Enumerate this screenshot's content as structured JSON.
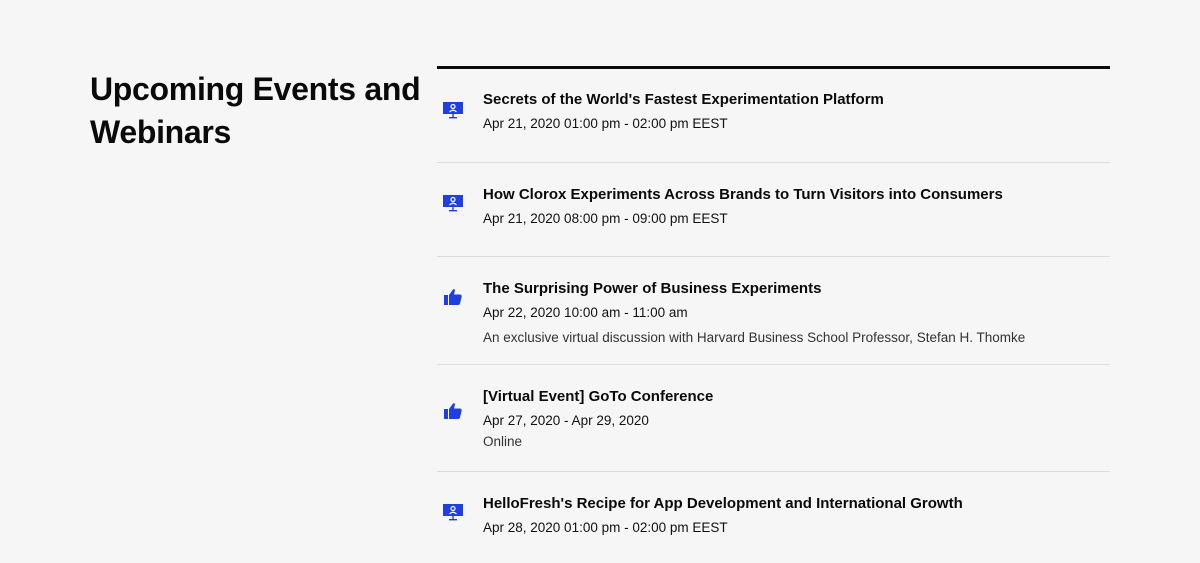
{
  "section": {
    "title": "Upcoming Events and Webinars"
  },
  "colors": {
    "accent": "#1f3fe0",
    "background": "#f6f6f6",
    "divider": "#dcdcdc",
    "text": "#0a0a0a"
  },
  "events": [
    {
      "icon": "webinar-icon",
      "title": "Secrets of the World's Fastest Experimentation Platform",
      "date": "Apr 21, 2020 01:00 pm - 02:00 pm EEST",
      "description": ""
    },
    {
      "icon": "webinar-icon",
      "title": "How Clorox Experiments Across Brands to Turn Visitors into Consumers",
      "date": "Apr 21, 2020 08:00 pm - 09:00 pm EEST",
      "description": ""
    },
    {
      "icon": "thumbs-up-icon",
      "title": "The Surprising Power of Business Experiments",
      "date": "Apr 22, 2020 10:00 am - 11:00 am",
      "description": "An exclusive virtual discussion with Harvard Business School Professor, Stefan H. Thomke"
    },
    {
      "icon": "thumbs-up-icon",
      "title": "[Virtual Event] GoTo Conference",
      "date": "Apr 27, 2020 - Apr 29, 2020",
      "description": "Online"
    },
    {
      "icon": "webinar-icon",
      "title": "HelloFresh's Recipe for App Development and International Growth",
      "date": "Apr 28, 2020 01:00 pm - 02:00 pm EEST",
      "description": ""
    }
  ]
}
